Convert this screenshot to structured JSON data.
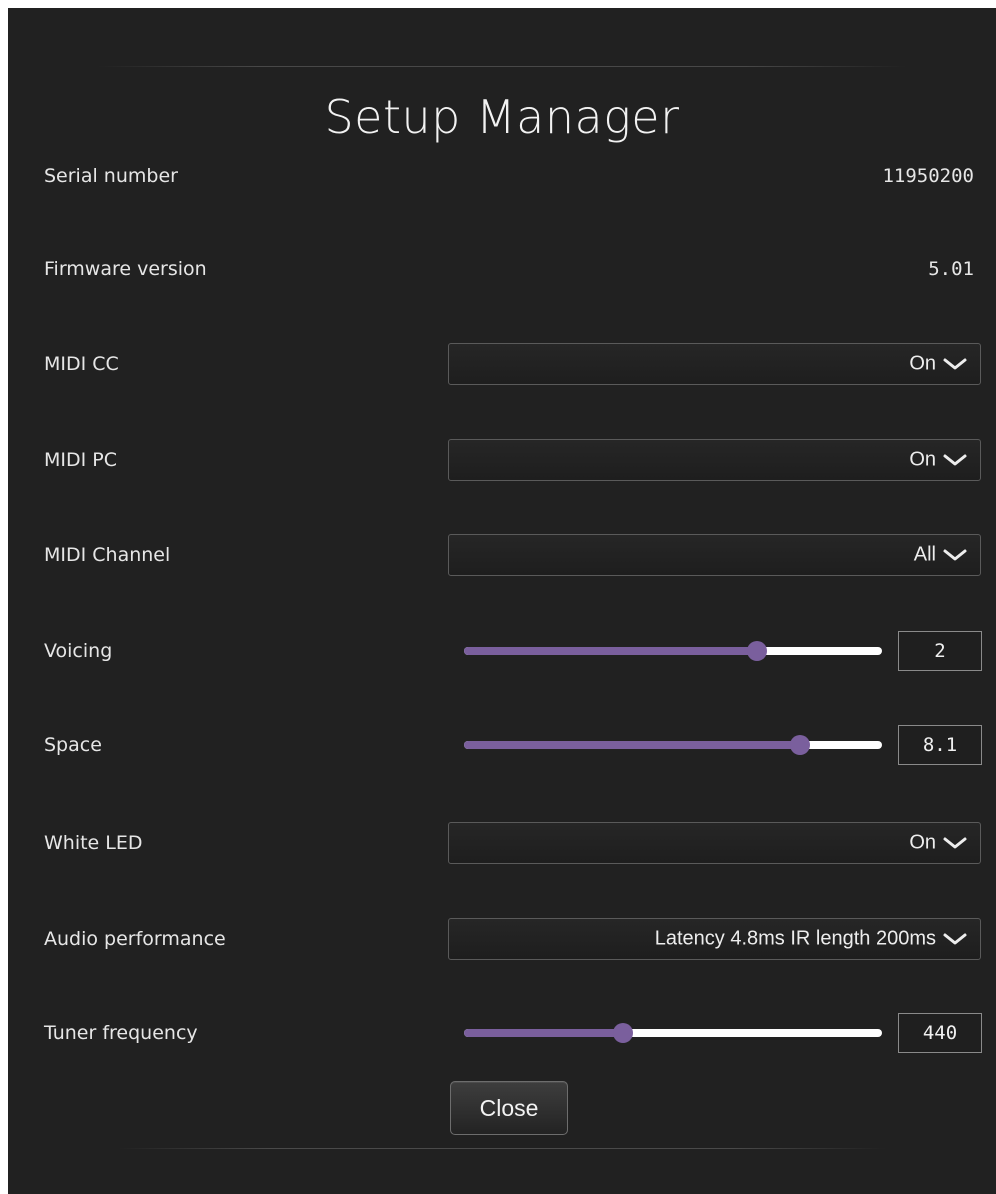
{
  "dialog": {
    "title": "Setup Manager",
    "close_label": "Close"
  },
  "rows": {
    "serial_number": {
      "label": "Serial number",
      "value": "11950200"
    },
    "firmware_version": {
      "label": "Firmware version",
      "value": "5.01"
    },
    "midi_cc": {
      "label": "MIDI CC",
      "selected": "On"
    },
    "midi_pc": {
      "label": "MIDI PC",
      "selected": "On"
    },
    "midi_channel": {
      "label": "MIDI Channel",
      "selected": "All"
    },
    "voicing": {
      "label": "Voicing",
      "value": "2",
      "slider_fraction": 0.7
    },
    "space": {
      "label": "Space",
      "value": "8.1",
      "slider_fraction": 0.805
    },
    "white_led": {
      "label": "White LED",
      "selected": "On"
    },
    "audio_performance": {
      "label": "Audio performance",
      "selected": "Latency 4.8ms IR length 200ms"
    },
    "tuner_frequency": {
      "label": "Tuner frequency",
      "value": "440",
      "slider_fraction": 0.38
    }
  },
  "icons": {
    "dropdown": "chevron-down-icon"
  },
  "colors": {
    "background": "#212121",
    "slider_accent": "#7a5f9d",
    "slider_track": "#ffffff",
    "text": "#e6e6e6"
  }
}
